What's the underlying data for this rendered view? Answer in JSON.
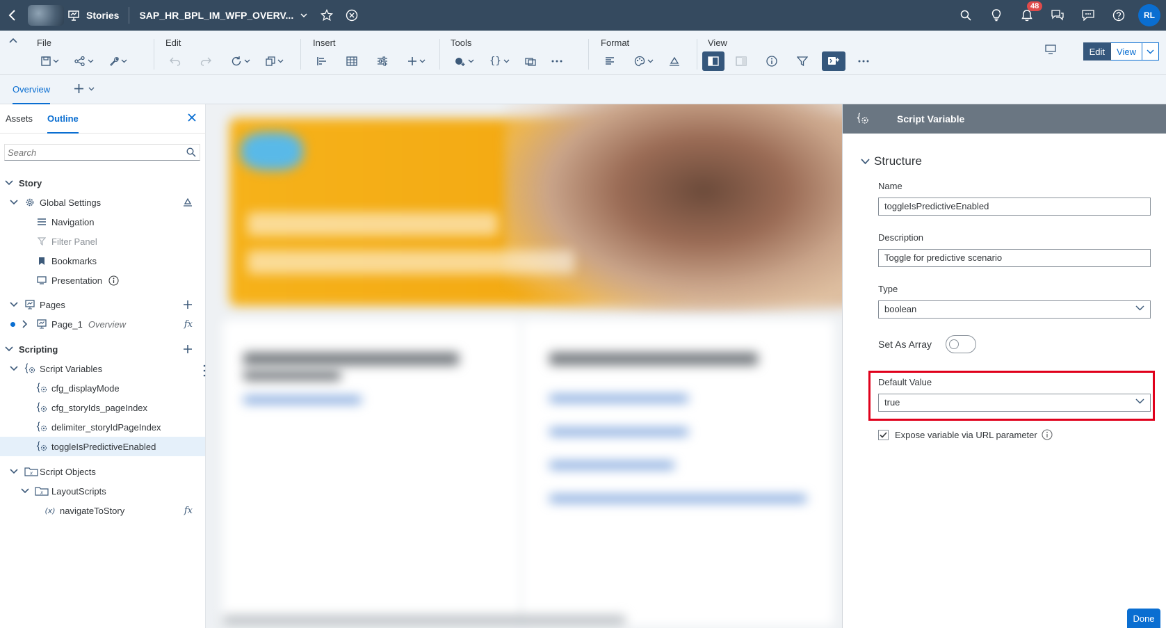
{
  "shell": {
    "app_name": "Stories",
    "story_title": "SAP_HR_BPL_IM_WFP_OVERV...",
    "notification_count": "48",
    "user_initials": "RL"
  },
  "toolbar": {
    "groups": {
      "file": "File",
      "edit": "Edit",
      "insert": "Insert",
      "tools": "Tools",
      "format": "Format",
      "view": "View"
    },
    "edit_label": "Edit",
    "view_label": "View"
  },
  "page_tabs": {
    "overview": "Overview"
  },
  "left_panel": {
    "tab_assets": "Assets",
    "tab_outline": "Outline",
    "search_placeholder": "Search",
    "tree": {
      "story": "Story",
      "global_settings": "Global Settings",
      "navigation": "Navigation",
      "filter_panel": "Filter Panel",
      "bookmarks": "Bookmarks",
      "presentation": "Presentation",
      "pages": "Pages",
      "page_1": "Page_1",
      "page_1_sub": "Overview",
      "scripting": "Scripting",
      "script_variables": "Script Variables",
      "vars": [
        "cfg_displayMode",
        "cfg_storyIds_pageIndex",
        "delimiter_storyIdPageIndex",
        "toggleIsPredictiveEnabled"
      ],
      "script_objects": "Script Objects",
      "layout_scripts": "LayoutScripts",
      "navigate_to_story": "navigateToStory"
    }
  },
  "right_panel": {
    "header_title": "Script Variable",
    "section_title": "Structure",
    "name_label": "Name",
    "name_value": "toggleIsPredictiveEnabled",
    "description_label": "Description",
    "description_value": "Toggle for predictive scenario",
    "type_label": "Type",
    "type_value": "boolean",
    "set_as_array_label": "Set As Array",
    "set_as_array": false,
    "default_value_label": "Default Value",
    "default_value": "true",
    "expose_label": "Expose variable via URL parameter",
    "expose_checked": true,
    "done_label": "Done"
  },
  "colors": {
    "shell_bg": "#354a5f",
    "accent": "#0a6ed1",
    "highlight_box": "#e0001b",
    "panel_header": "#6a7682"
  }
}
